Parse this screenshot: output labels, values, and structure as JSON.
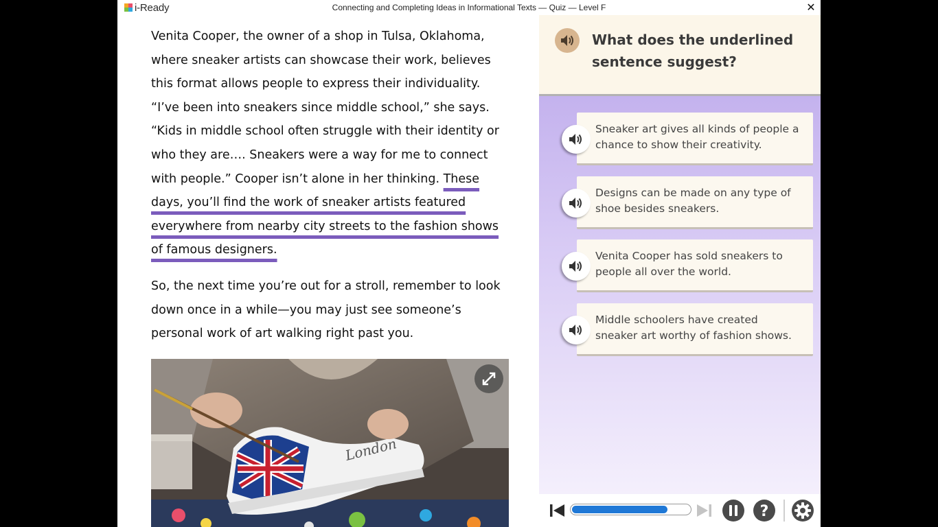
{
  "app": {
    "logo_text": "i-Ready",
    "window_title": "Connecting and Completing Ideas in Informational Texts — Quiz — Level F",
    "close_symbol": "✕"
  },
  "passage": {
    "p1_plain": "Venita Cooper, the owner of a shop in Tulsa, Oklahoma, where sneaker artists can showcase their work, believes this format allows people to express their individuality. “I’ve been into sneakers since middle school,” she says. “Kids in middle school often struggle with their identity or who they are…. Sneakers were a way for me to connect with people.” Cooper isn’t alone in her thinking. ",
    "p1_underlined": "These days, you’ll find the work of sneaker artists featured everywhere from nearby city streets to the fashion shows of famous designers.",
    "p2": "So, the next time you’re out for a stroll, remember to look down once in a while—you may just see someone’s personal work of art walking right past you.",
    "image_lettering": "London"
  },
  "question": {
    "text": "What does the underlined sentence suggest?",
    "answers": [
      {
        "text": "Sneaker art gives all kinds of people a chance to show their creativity."
      },
      {
        "text": "Designs can be made on any type of shoe besides sneakers."
      },
      {
        "text": "Venita Cooper has sold sneakers to people all over the world."
      },
      {
        "text": "Middle schoolers have created sneaker art worthy of fashion shows."
      }
    ]
  },
  "controls": {
    "progress_fraction": 0.81,
    "icons": [
      "speaker-icon",
      "skip-back-icon",
      "skip-forward-icon",
      "pause-icon",
      "help-icon",
      "settings-icon",
      "expand-icon",
      "close-icon"
    ]
  },
  "colors": {
    "underline": "#7b5cbc",
    "question_bg": "#fcf6e9",
    "audio_button": "#d7b58f",
    "panel_top": "#b9a5ea",
    "progress": "#1f78d6"
  }
}
